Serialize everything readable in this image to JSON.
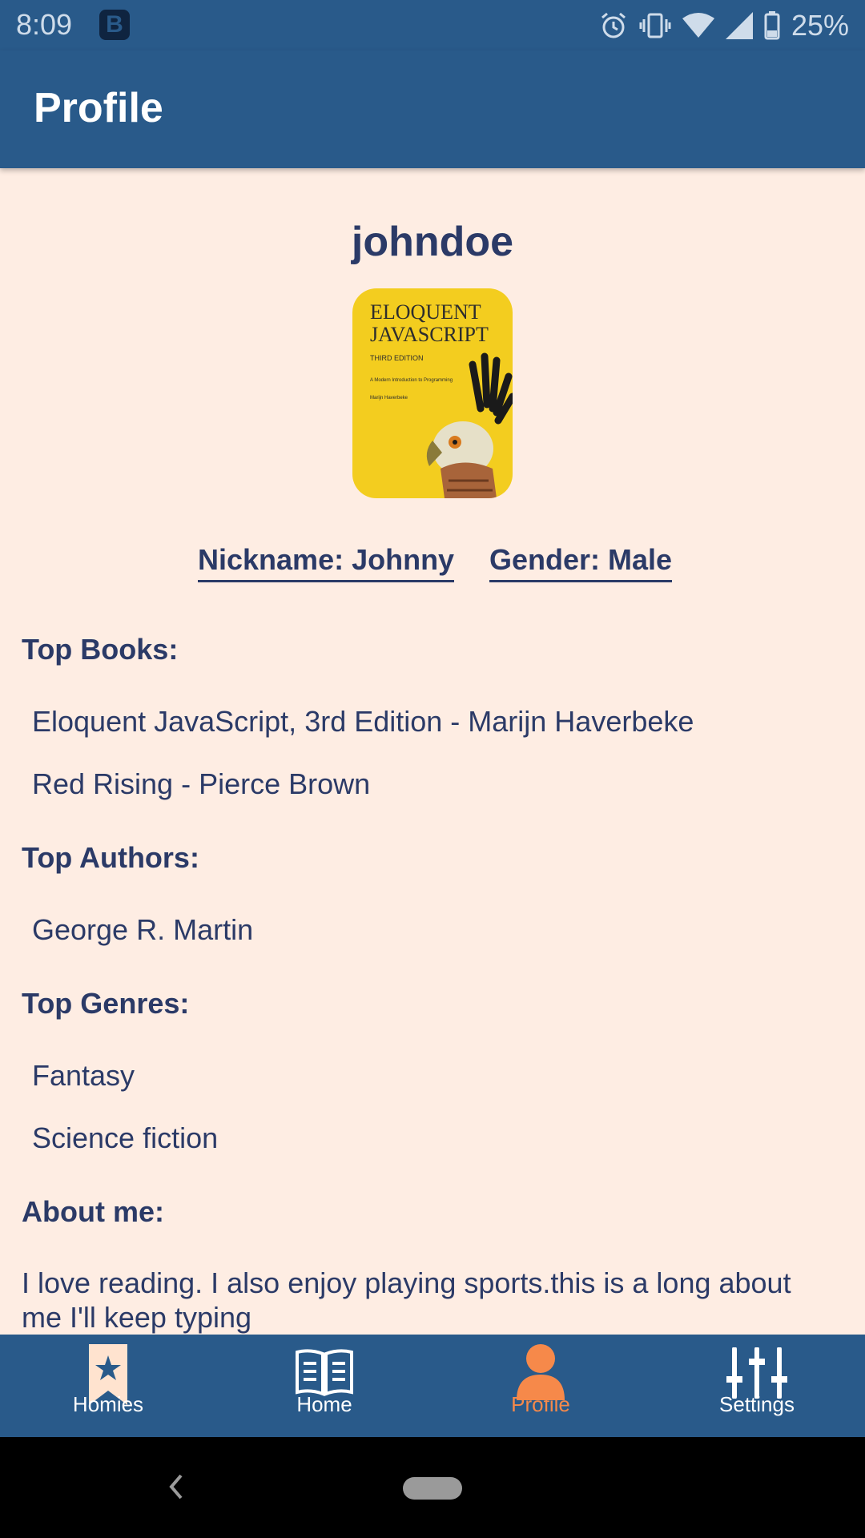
{
  "status_bar": {
    "time": "8:09",
    "app_badge": "B",
    "battery": "25%",
    "icons": [
      "alarm-icon",
      "vibrate-icon",
      "wifi-icon",
      "signal-icon",
      "battery-icon"
    ]
  },
  "app_bar": {
    "title": "Profile"
  },
  "profile": {
    "username": "johndoe",
    "avatar_title_line1": "ELOQUENT",
    "avatar_title_line2": "JAVASCRIPT",
    "avatar_edition": "THIRD EDITION",
    "avatar_subtitle": "A Modern Introduction to Programming",
    "avatar_author": "Marijn Haverbeke",
    "nickname": "Nickname: Johnny",
    "gender": "Gender: Male"
  },
  "sections": {
    "top_books": {
      "heading": "Top Books:",
      "items": [
        "Eloquent JavaScript, 3rd Edition - Marijn Haverbeke",
        "Red Rising - Pierce Brown"
      ]
    },
    "top_authors": {
      "heading": "Top Authors:",
      "items": [
        "George R. Martin"
      ]
    },
    "top_genres": {
      "heading": "Top Genres:",
      "items": [
        "Fantasy",
        "Science fiction"
      ]
    },
    "about": {
      "heading": "About me:",
      "text": "I love reading. I also enjoy playing sports.this is a long about me I'll keep typing"
    }
  },
  "bottom_nav": {
    "items": [
      {
        "label": "Homies",
        "icon": "bookmark-star-icon",
        "active": false
      },
      {
        "label": "Home",
        "icon": "book-icon",
        "active": false
      },
      {
        "label": "Profile",
        "icon": "person-icon",
        "active": true
      },
      {
        "label": "Settings",
        "icon": "sliders-icon",
        "active": false
      }
    ]
  },
  "colors": {
    "primary": "#295a8a",
    "background": "#feede3",
    "text": "#2b3a67",
    "accent": "#f6894a"
  }
}
